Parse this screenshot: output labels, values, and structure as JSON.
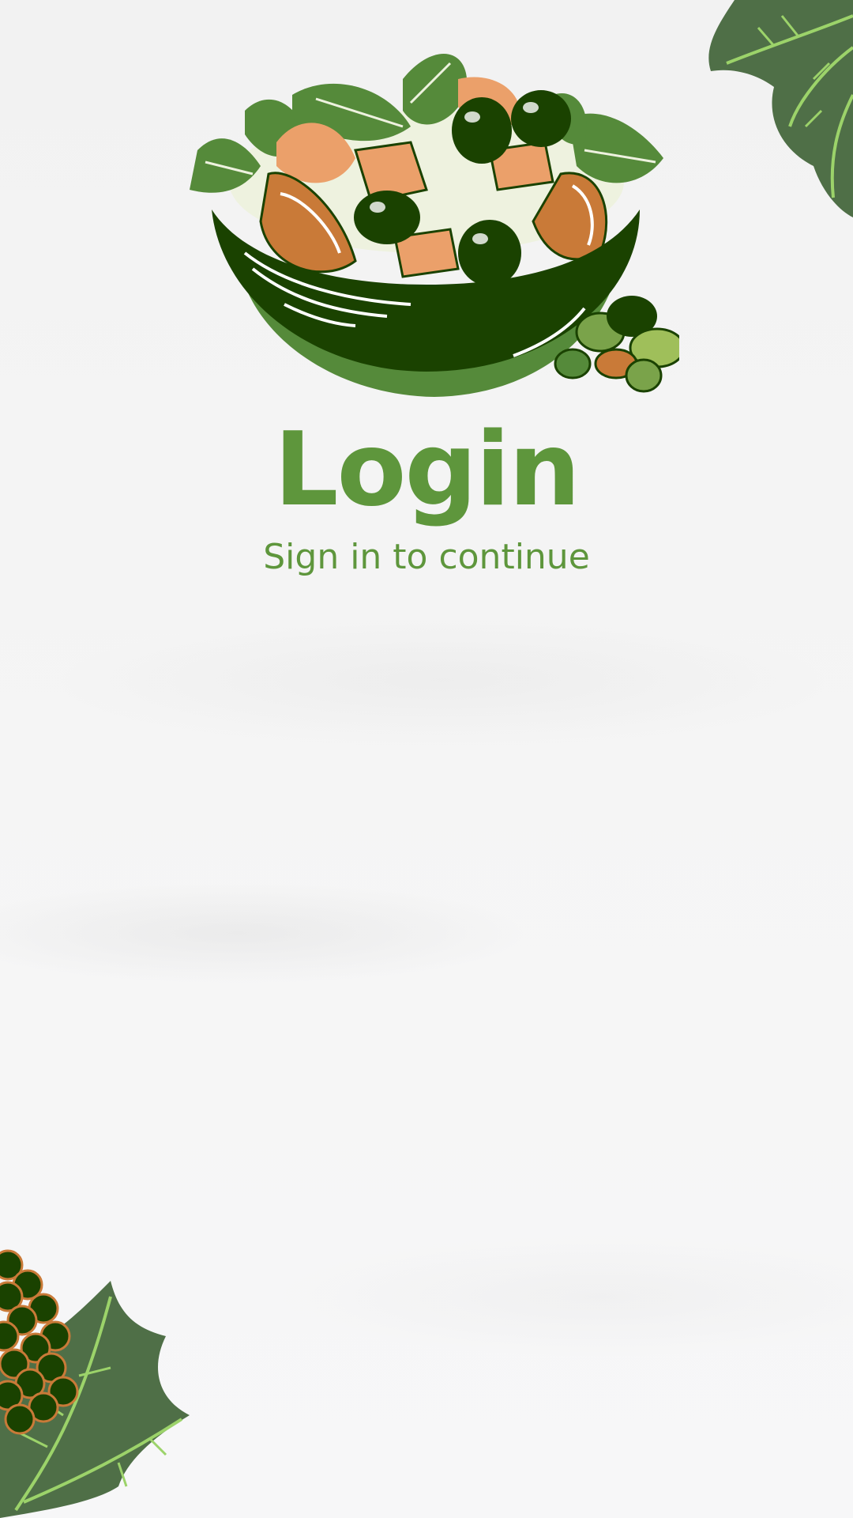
{
  "colors": {
    "brand_green": "#5e963c",
    "dark_green": "#1a4200",
    "leaf_green": "#558a3a",
    "orange": "#c97a38",
    "light_orange": "#eba06a",
    "background": "#f3f3f3"
  },
  "hero": {
    "icon": "salad-bowl-icon"
  },
  "header": {
    "title": "Login",
    "subtitle": "Sign in to continue"
  },
  "decorations": {
    "top_right": "leaf-icon",
    "bottom_left": "grape-leaf-icon"
  }
}
